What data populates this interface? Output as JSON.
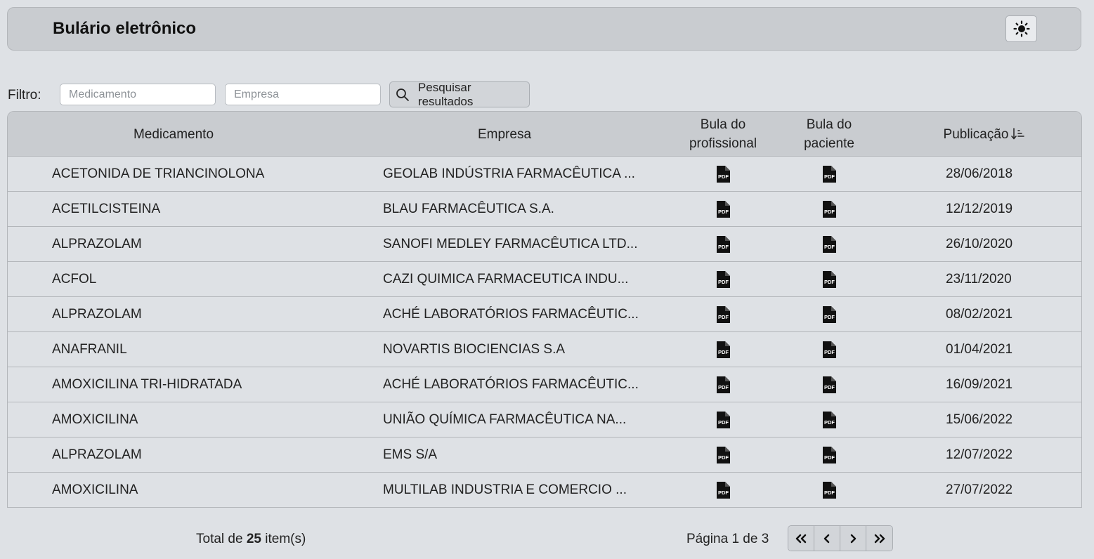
{
  "header": {
    "title": "Bulário eletrônico",
    "theme_icon": "sun-icon"
  },
  "filter": {
    "label": "Filtro:",
    "medicamento_placeholder": "Medicamento",
    "empresa_placeholder": "Empresa",
    "search_label": "Pesquisar resultados",
    "search_icon": "search-icon"
  },
  "table": {
    "headers": {
      "medicamento": "Medicamento",
      "empresa": "Empresa",
      "profissional_1": "Bula do",
      "profissional_2": "profissional",
      "paciente_1": "Bula do",
      "paciente_2": "paciente",
      "publicacao": "Publicação",
      "sort_icon": "sort-ascending-icon"
    },
    "pdf_icon": "pdf-file-icon",
    "rows": [
      {
        "medicamento": "ACETONIDA DE TRIANCINOLONA",
        "empresa": "GEOLAB INDÚSTRIA FARMACÊUTICA ...",
        "publicacao": "28/06/2018"
      },
      {
        "medicamento": "ACETILCISTEINA",
        "empresa": "BLAU FARMACÊUTICA S.A.",
        "publicacao": "12/12/2019"
      },
      {
        "medicamento": "ALPRAZOLAM",
        "empresa": "SANOFI MEDLEY FARMACÊUTICA LTD...",
        "publicacao": "26/10/2020"
      },
      {
        "medicamento": "ACFOL",
        "empresa": "CAZI QUIMICA FARMACEUTICA INDU...",
        "publicacao": "23/11/2020"
      },
      {
        "medicamento": "ALPRAZOLAM",
        "empresa": "ACHÉ LABORATÓRIOS FARMACÊUTIC...",
        "publicacao": "08/02/2021"
      },
      {
        "medicamento": "ANAFRANIL",
        "empresa": "NOVARTIS BIOCIENCIAS S.A",
        "publicacao": "01/04/2021"
      },
      {
        "medicamento": "AMOXICILINA TRI-HIDRATADA",
        "empresa": "ACHÉ LABORATÓRIOS FARMACÊUTIC...",
        "publicacao": "16/09/2021"
      },
      {
        "medicamento": "AMOXICILINA",
        "empresa": "UNIÃO QUÍMICA FARMACÊUTICA NA...",
        "publicacao": "15/06/2022"
      },
      {
        "medicamento": "ALPRAZOLAM",
        "empresa": "EMS S/A",
        "publicacao": "12/07/2022"
      },
      {
        "medicamento": "AMOXICILINA",
        "empresa": "MULTILAB INDUSTRIA E COMERCIO ...",
        "publicacao": "27/07/2022"
      }
    ]
  },
  "footer": {
    "total_prefix": "Total de",
    "total_count": "25",
    "total_suffix": "item(s)",
    "page_info": "Página 1 de 3",
    "pager_icons": [
      "first-page-icon",
      "previous-page-icon",
      "next-page-icon",
      "last-page-icon"
    ]
  }
}
